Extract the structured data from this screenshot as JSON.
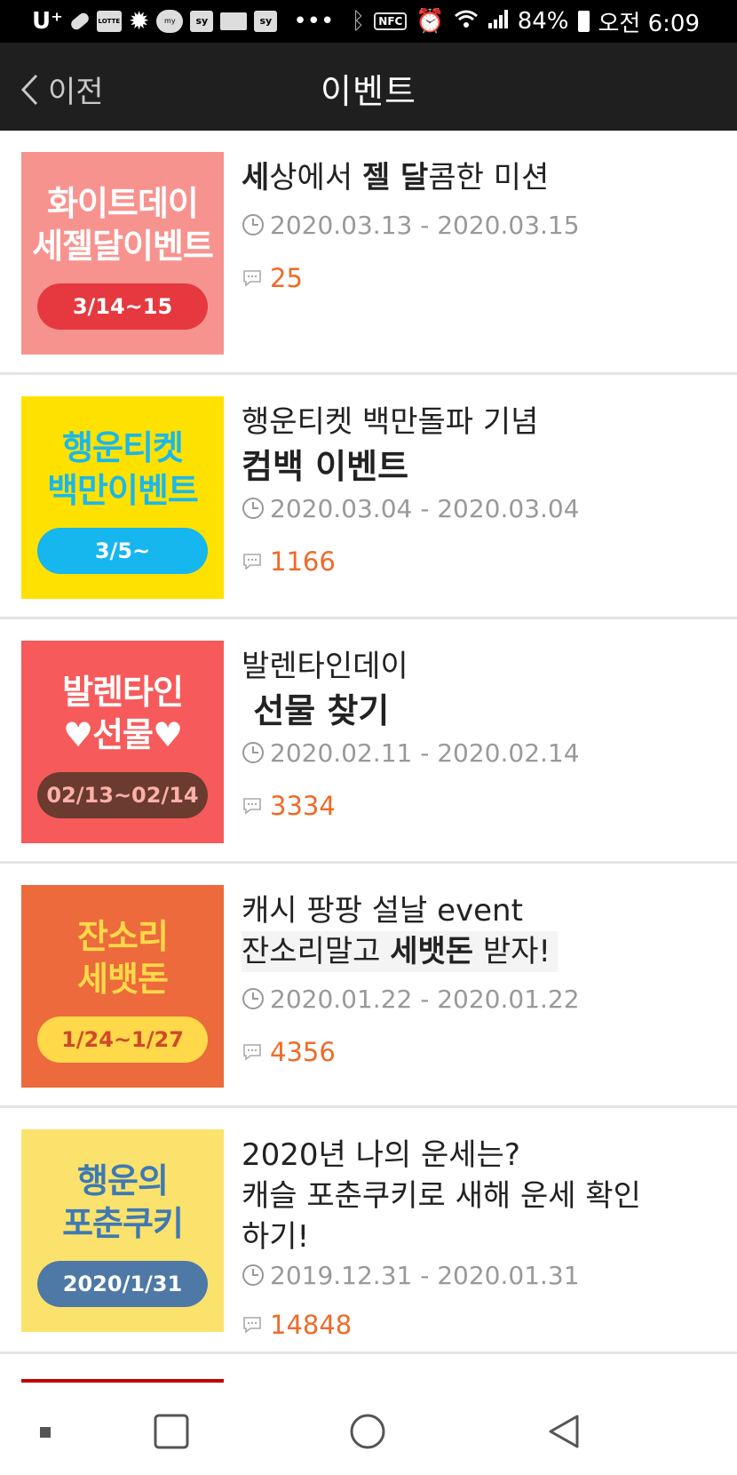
{
  "status_bar": {
    "carrier": "U⁺",
    "battery_percent": "84%",
    "time": "오전 6:09",
    "nfc_label": "NFC",
    "notif_labels": [
      "LOTTE",
      "my",
      "sy",
      "sy"
    ],
    "more": "•••"
  },
  "header": {
    "back_label": "이전",
    "title": "이벤트"
  },
  "events": [
    {
      "thumb": {
        "line1": "화이트데이",
        "line2": "세젤달이벤트",
        "pill": "3/14~15",
        "bg": "#f7938f",
        "text": "#ffffff",
        "pill_bg": "#e6383f",
        "pill_text": "#ffffff"
      },
      "title_a1": "세",
      "title_n1": "상에서 ",
      "title_a2": "젤 달",
      "title_n2": "콤한 미션",
      "date": "2020.03.13 - 2020.03.15",
      "comments": "25"
    },
    {
      "thumb": {
        "line1": "행운티켓",
        "line2": "백만이벤트",
        "pill": "3/5~",
        "bg": "#ffe100",
        "text": "#1ab8ea",
        "pill_bg": "#16b6ee",
        "pill_text": "#ffffff"
      },
      "title_line1": "행운티켓 백만돌파 기념",
      "title_line2": "컴백 이벤트",
      "date": "2020.03.04 - 2020.03.04",
      "comments": "1166"
    },
    {
      "thumb": {
        "line1": "발렌타인",
        "line2": "♥선물♥",
        "pill": "02/13~02/14",
        "bg": "#f65a5a",
        "text": "#ffffff",
        "pill_bg": "#6b3b30",
        "pill_text": "#ffb0a8"
      },
      "title_line1": "발렌타인데이",
      "title_line2": " 선물 찾기",
      "date": "2020.02.11 - 2020.02.14",
      "comments": "3334"
    },
    {
      "thumb": {
        "line1": "잔소리",
        "line2": "세뱃돈",
        "pill": "1/24~1/27",
        "bg": "#ec6a3b",
        "text": "#ffd94a",
        "pill_bg": "#ffd94a",
        "pill_text": "#d1492a"
      },
      "title_line1": "캐시 팡팡 설날 event",
      "title_l2a": "잔소리말고 ",
      "title_l2b": "세뱃돈",
      "title_l2c": " 받자!",
      "date": "2020.01.22 - 2020.01.22",
      "comments": "4356"
    },
    {
      "thumb": {
        "line1": "행운의",
        "line2": "포춘쿠키",
        "pill": "2020/1/31",
        "bg": "#fbe26c",
        "text": "#3e79b4",
        "pill_bg": "#4e79a6",
        "pill_text": "#ffffff"
      },
      "title_line1": "2020년 나의 운세는?",
      "title_line2": "캐슬 포춘쿠키로 새해 운세 확인",
      "title_line3": "하기!",
      "date": "2019.12.31 - 2020.01.31",
      "comments": "14848"
    }
  ],
  "nav": {
    "icons": [
      "recent-dot-icon",
      "square-icon",
      "home-circle-icon",
      "back-triangle-icon"
    ]
  }
}
